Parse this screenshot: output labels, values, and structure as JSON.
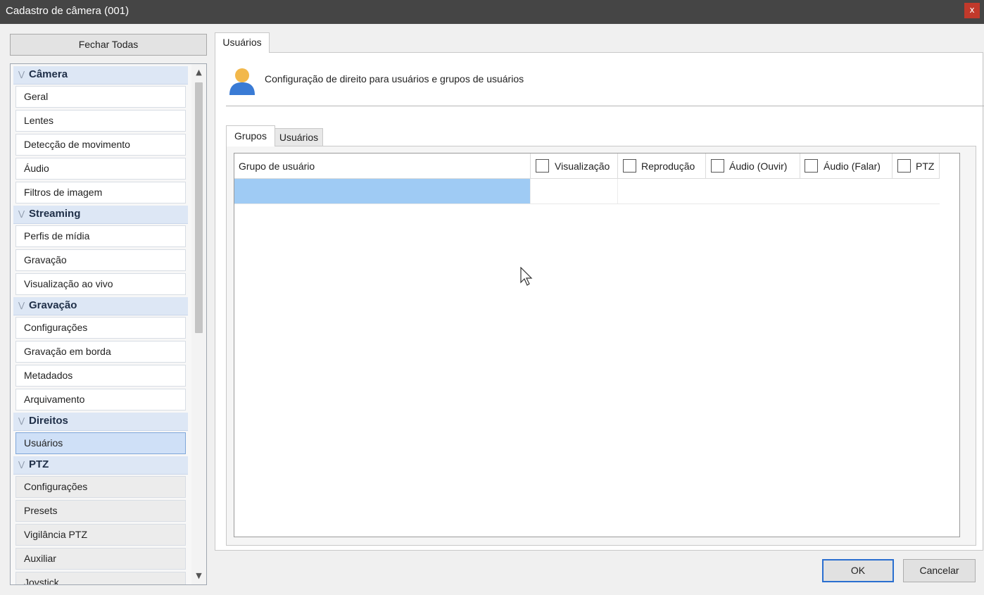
{
  "window": {
    "title": "Cadastro de câmera (001)",
    "close_glyph": "x"
  },
  "sidebar": {
    "close_all_label": "Fechar Todas",
    "groups": [
      {
        "label": "Câmera",
        "items": [
          "Geral",
          "Lentes",
          "Detecção de movimento",
          "Áudio",
          "Filtros de imagem"
        ]
      },
      {
        "label": "Streaming",
        "items": [
          "Perfis de mídia",
          "Gravação",
          "Visualização ao vivo"
        ]
      },
      {
        "label": "Gravação",
        "items": [
          "Configurações",
          "Gravação em borda",
          "Metadados",
          "Arquivamento"
        ]
      },
      {
        "label": "Direitos",
        "items": [
          "Usuários"
        ]
      },
      {
        "label": "PTZ",
        "items": [
          "Configurações",
          "Presets",
          "Vigilância PTZ",
          "Auxiliar",
          "Joystick"
        ]
      }
    ],
    "selected_item": "Usuários"
  },
  "main": {
    "tab_label": "Usuários",
    "header_text": "Configuração de direito para usuários e grupos de usuários",
    "inner_tabs": [
      "Grupos",
      "Usuários"
    ],
    "active_inner_tab": "Grupos",
    "table": {
      "columns": [
        "Grupo de usuário",
        "Visualização",
        "Reprodução",
        "Áudio (Ouvir)",
        "Áudio (Falar)",
        "PTZ"
      ]
    }
  },
  "footer": {
    "ok_label": "OK",
    "cancel_label": "Cancelar"
  },
  "icons": {
    "user": "user-icon",
    "collapse": "chevron-double-down-icon",
    "scroll_up": "arrow-up-icon",
    "scroll_down": "arrow-down-icon"
  },
  "colors": {
    "titlebar": "#454545",
    "close_button": "#c1392b",
    "selection": "#9fcbf4",
    "ok_border": "#2a6fd0"
  }
}
